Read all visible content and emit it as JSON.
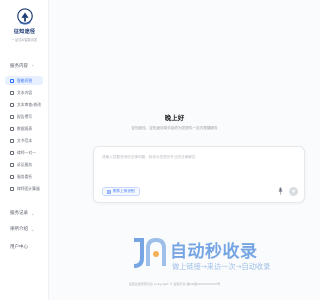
{
  "brand": {
    "name": "征知途径",
    "tagline": "一站式AI智能问答"
  },
  "sidebar": {
    "section_service": "服务内容",
    "items": [
      {
        "label": "智能问答",
        "active": true
      },
      {
        "label": "文本内容",
        "active": false
      },
      {
        "label": "文本审查/修改",
        "active": false
      },
      {
        "label": "报告撰写",
        "active": false
      },
      {
        "label": "数据报表",
        "active": false
      },
      {
        "label": "文书范本",
        "active": false
      },
      {
        "label": "律师一对一",
        "active": false
      },
      {
        "label": "诉讼服务",
        "active": false
      },
      {
        "label": "服务委托",
        "active": false
      },
      {
        "label": "律师团计算器",
        "active": false
      }
    ],
    "section_records": "服务记录",
    "section_intro": "律所介绍",
    "section_user": "用户中心"
  },
  "main": {
    "title": "晚上好",
    "description": "征知途径，征知途径助手始终为您提供一站式便捷服务",
    "input_placeholder": "请输入您要咨询的法律问题，我将为您提供专业的法律解答",
    "upload_label": "附件上传识别",
    "footer": "征知途径智慧平台  Copyright © 征知平台  湘ICP备2025XXXXXX号"
  },
  "watermark": {
    "title": "自动秒收录",
    "subtitle": "做上链接→来访一次→自动收录"
  },
  "colors": {
    "accent": "#2f6df6",
    "active_bg": "#e8f0ff",
    "watermark": "#5f97df"
  }
}
